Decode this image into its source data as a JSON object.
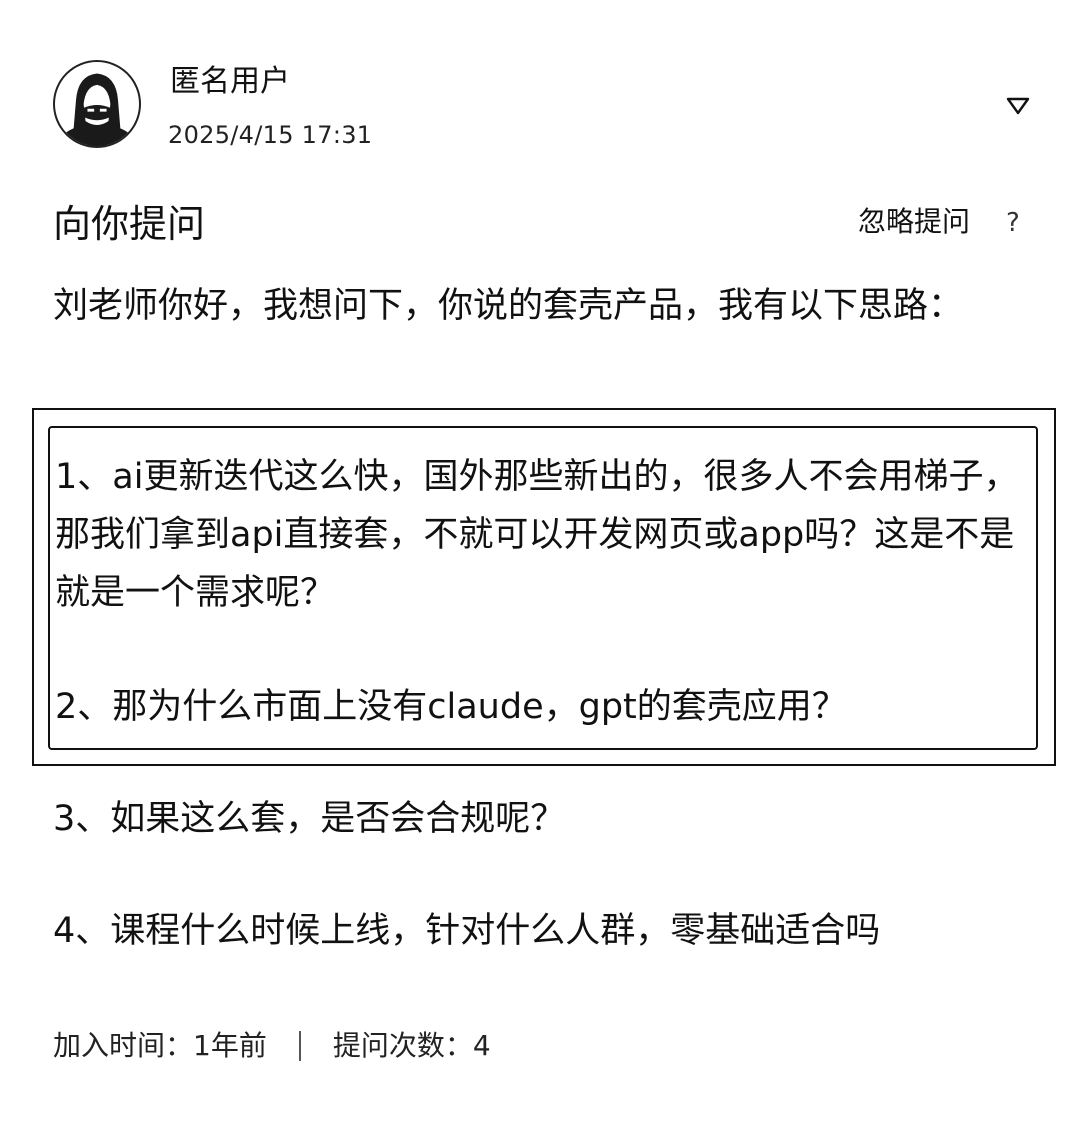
{
  "header": {
    "user_name": "匿名用户",
    "post_time": "2025/4/15 17:31",
    "avatar_icon": "masked-avatar-icon",
    "menu_icon": "chevron-down-icon"
  },
  "question": {
    "title": "向你提问",
    "ignore_label": "忽略提问",
    "help_icon_glyph": "?",
    "intro": "刘老师你好，我想问下，你说的套壳产品，我有以下思路：",
    "points": [
      "1、ai更新迭代这么快，国外那些新出的，很多人不会用梯子，那我们拿到api直接套，不就可以开发网页或app吗？这是不是就是一个需求呢？",
      "2、那为什么市面上没有claude，gpt的套壳应用？",
      "3、如果这么套，是否会合规呢？",
      "4、课程什么时候上线，针对什么人群，零基础适合吗"
    ]
  },
  "meta": {
    "join_label": "加入时间：1年前",
    "question_count_label": "提问次数：4"
  }
}
